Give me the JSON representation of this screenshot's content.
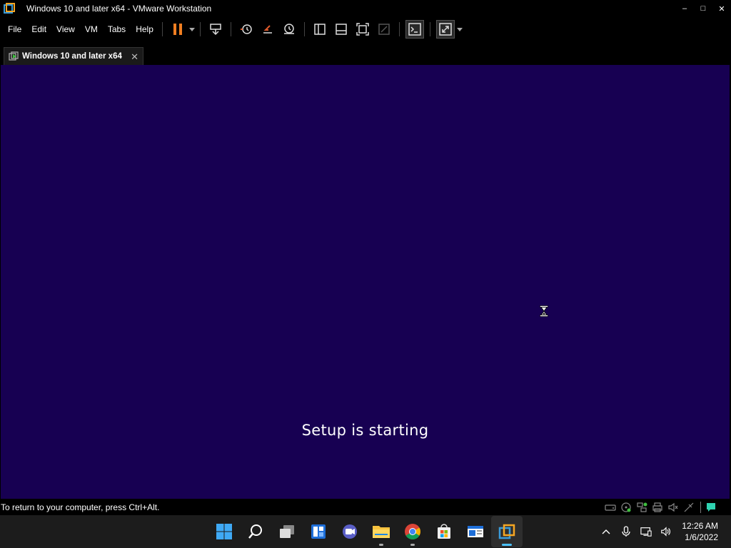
{
  "window": {
    "title": "Windows 10 and later x64 - VMware Workstation",
    "controls": {
      "minimize": "–",
      "maximize": "□",
      "close": "✕"
    }
  },
  "menu": {
    "items": [
      "File",
      "Edit",
      "View",
      "VM",
      "Tabs",
      "Help"
    ]
  },
  "toolbar": {
    "buttons": [
      "pause-icon",
      "send-ctrl-alt-del-icon",
      "snapshot-icon",
      "revert-snapshot-icon",
      "snapshot-manager-icon",
      "show-library-icon",
      "thumbnail-bar-icon",
      "full-screen-icon",
      "unity-icon",
      "console-view-icon",
      "stretch-guest-icon"
    ]
  },
  "tabs": [
    {
      "label": "Windows 10 and later x64",
      "close": "✕"
    }
  ],
  "console": {
    "message": "Setup is starting",
    "background": "#170052"
  },
  "status": {
    "hint": "To return to your computer, press Ctrl+Alt.",
    "devices": [
      "hard-disk-icon",
      "cd-dvd-icon",
      "network-adapter-icon",
      "printer-icon",
      "sound-card-icon",
      "usb-icon",
      "message-log-icon"
    ]
  },
  "taskbar": {
    "apps": [
      "start-icon",
      "search-icon",
      "task-view-icon",
      "widgets-icon",
      "teams-chat-icon",
      "file-explorer-icon",
      "chrome-icon",
      "microsoft-store-icon",
      "app-icon",
      "vmware-workstation-icon"
    ],
    "tray": [
      "show-hidden-icons-icon",
      "microphone-icon",
      "network-icon",
      "volume-icon"
    ],
    "time": "12:26 AM",
    "date": "1/6/2022"
  }
}
